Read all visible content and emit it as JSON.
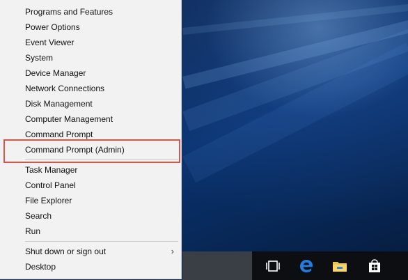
{
  "menu": {
    "items": [
      {
        "label": "Programs and Features"
      },
      {
        "label": "Power Options"
      },
      {
        "label": "Event Viewer"
      },
      {
        "label": "System"
      },
      {
        "label": "Device Manager"
      },
      {
        "label": "Network Connections"
      },
      {
        "label": "Disk Management"
      },
      {
        "label": "Computer Management"
      },
      {
        "label": "Command Prompt"
      },
      {
        "label": "Command Prompt (Admin)"
      },
      {
        "label": "Task Manager"
      },
      {
        "label": "Control Panel"
      },
      {
        "label": "File Explorer"
      },
      {
        "label": "Search"
      },
      {
        "label": "Run"
      },
      {
        "label": "Shut down or sign out"
      },
      {
        "label": "Desktop"
      }
    ],
    "highlight_color": "#d9544a"
  },
  "taskbar": {
    "icons": [
      "task-view-icon",
      "edge-icon",
      "file-explorer-icon",
      "store-icon"
    ],
    "edge_color": "#1f7ee0",
    "explorer_color": "#f4c542"
  }
}
